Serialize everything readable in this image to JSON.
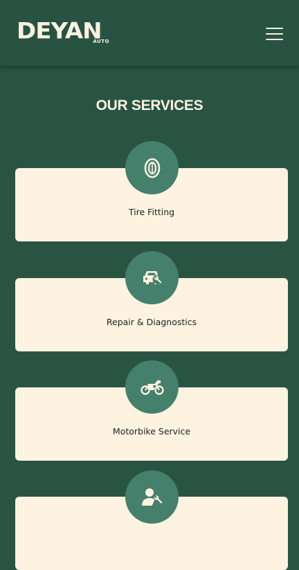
{
  "header": {
    "logo_text": "DEYAN",
    "logo_subtext": "AUTO"
  },
  "section": {
    "title": "OUR SERVICES"
  },
  "services": [
    {
      "label": "Tire Fitting",
      "icon": "tire-icon"
    },
    {
      "label": "Repair & Diagnostics",
      "icon": "car-repair-icon"
    },
    {
      "label": "Motorbike Service",
      "icon": "motorbike-icon"
    },
    {
      "label": "",
      "icon": "mechanic-icon"
    }
  ],
  "colors": {
    "background": "#295444",
    "card": "#fdf3e0",
    "icon_circle": "#44806b",
    "text_light": "#fbf2df"
  }
}
